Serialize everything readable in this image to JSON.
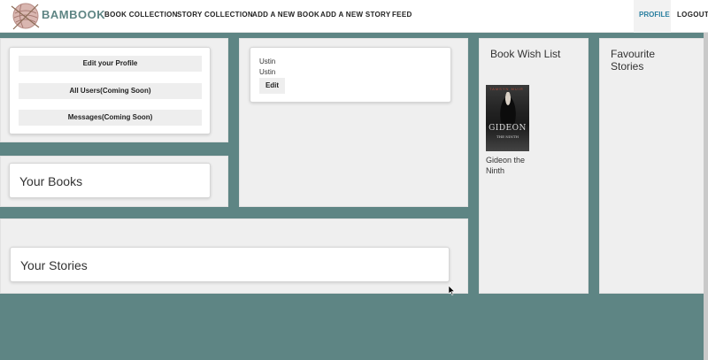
{
  "brand": {
    "name": "BAMBOOK",
    "logo_icon": "yarn-ball-icon"
  },
  "nav": {
    "links": [
      "BOOK COLLECTION",
      "STORY COLLECTION",
      "ADD A NEW BOOK",
      "ADD A NEW STORY",
      "FEED"
    ],
    "profile": "PROFILE",
    "logout": "LOGOUT"
  },
  "profile_menu": {
    "edit_profile": "Edit your Profile",
    "all_users": "All Users(Coming Soon)",
    "messages": "Messages(Coming Soon)"
  },
  "your_books": {
    "title": "Your Books"
  },
  "your_stories": {
    "title": "Your Stories"
  },
  "user_card": {
    "name_line_1": "Ustin",
    "name_line_2": "Ustin",
    "edit_label": "Edit"
  },
  "wish_list": {
    "title": "Book Wish List",
    "books": [
      {
        "title": "Gideon the Ninth",
        "cover_title": "GIDEON",
        "cover_subtitle": "THE NINTH",
        "cover_author": "TAMSYN MUIR"
      }
    ]
  },
  "favourite_stories": {
    "title": "Favourite Stories"
  },
  "colors": {
    "page_bg": "#5e8584",
    "brand": "#5e8584",
    "active_nav": "#2a7fa0",
    "panel_bg": "#efefef"
  }
}
